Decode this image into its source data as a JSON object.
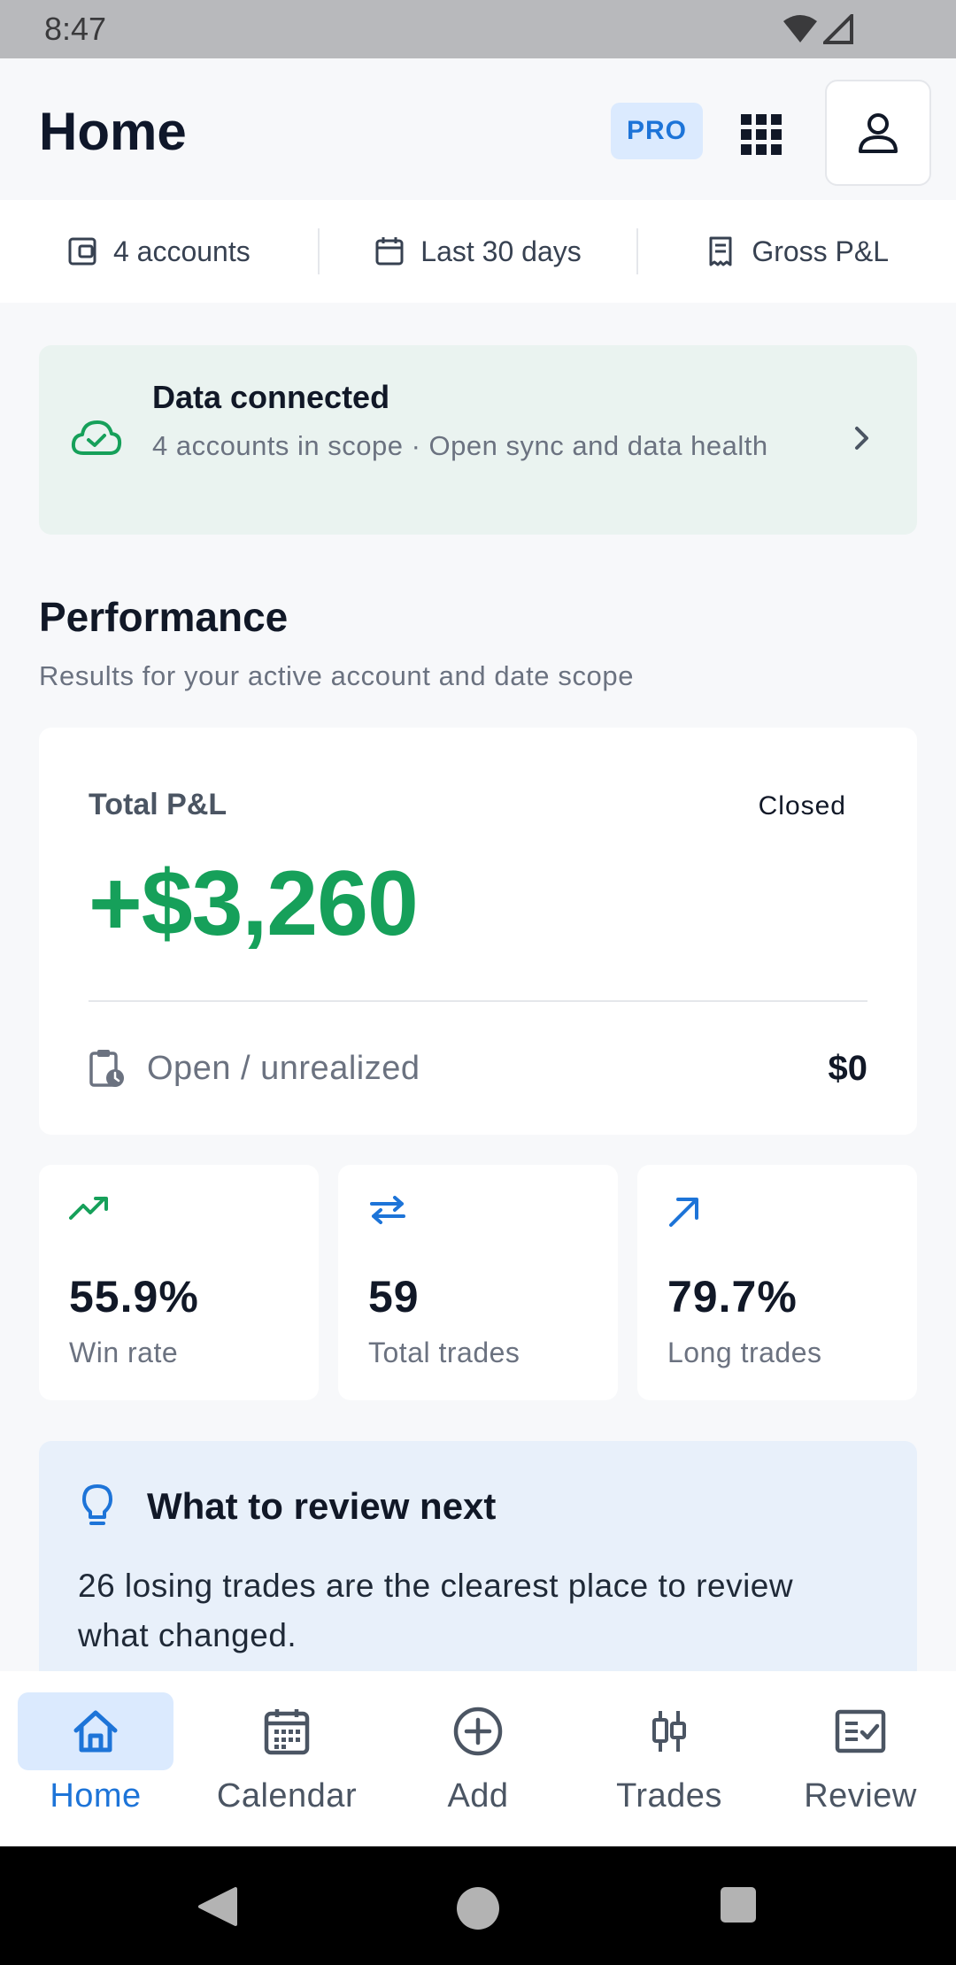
{
  "status_bar": {
    "time": "8:47"
  },
  "header": {
    "title": "Home",
    "pro_badge": "PRO"
  },
  "scope": {
    "accounts": "4 accounts",
    "date_range": "Last 30 days",
    "pnl_mode": "Gross P&L"
  },
  "data_status": {
    "title": "Data connected",
    "subtitle": "4 accounts in scope · Open sync and data health"
  },
  "performance": {
    "title": "Performance",
    "subtitle": "Results for your active account and date scope",
    "total_label": "Total P&L",
    "total_state": "Closed",
    "total_value": "+$3,260",
    "open_label": "Open / unrealized",
    "open_value": "$0"
  },
  "stats": [
    {
      "value": "55.9%",
      "label": "Win rate",
      "icon": "trending-up-icon",
      "color": "#16a05a"
    },
    {
      "value": "59",
      "label": "Total trades",
      "icon": "swap-arrows-icon",
      "color": "#1d74d8"
    },
    {
      "value": "79.7%",
      "label": "Long trades",
      "icon": "arrow-up-right-icon",
      "color": "#1d74d8"
    }
  ],
  "review": {
    "title": "What to review next",
    "text": "26 losing trades are the clearest place to review what changed."
  },
  "nav": [
    {
      "label": "Home",
      "icon": "home-icon",
      "active": true
    },
    {
      "label": "Calendar",
      "icon": "calendar-icon"
    },
    {
      "label": "Add",
      "icon": "add-circle-icon"
    },
    {
      "label": "Trades",
      "icon": "candlestick-icon"
    },
    {
      "label": "Review",
      "icon": "review-checklist-icon"
    }
  ],
  "colors": {
    "accent": "#1d74d8",
    "positive": "#16a05a",
    "background": "#f7f8fa"
  }
}
